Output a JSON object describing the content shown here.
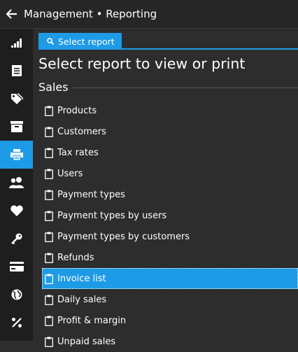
{
  "header": {
    "title": "Management • Reporting"
  },
  "sidebar": {
    "items": [
      {
        "icon": "chart-bars-icon"
      },
      {
        "icon": "document-icon"
      },
      {
        "icon": "tags-icon"
      },
      {
        "icon": "archive-box-icon"
      },
      {
        "icon": "printer-icon",
        "active": true
      },
      {
        "icon": "users-icon"
      },
      {
        "icon": "heart-icon"
      },
      {
        "icon": "key-icon"
      },
      {
        "icon": "credit-card-icon"
      },
      {
        "icon": "globe-icon"
      },
      {
        "icon": "percent-icon"
      }
    ]
  },
  "tab": {
    "label": "Select report"
  },
  "page": {
    "title": "Select report to view or print"
  },
  "section": {
    "label": "Sales"
  },
  "reports": [
    {
      "label": "Products"
    },
    {
      "label": "Customers"
    },
    {
      "label": "Tax rates"
    },
    {
      "label": "Users"
    },
    {
      "label": "Payment types"
    },
    {
      "label": "Payment types by users"
    },
    {
      "label": "Payment types by customers"
    },
    {
      "label": "Refunds"
    },
    {
      "label": "Invoice list",
      "selected": true
    },
    {
      "label": "Daily sales"
    },
    {
      "label": "Profit & margin"
    },
    {
      "label": "Unpaid sales"
    }
  ],
  "colors": {
    "accent": "#1e9be6",
    "background": "#2d2d2d",
    "sidebar": "#1e1e1e"
  }
}
